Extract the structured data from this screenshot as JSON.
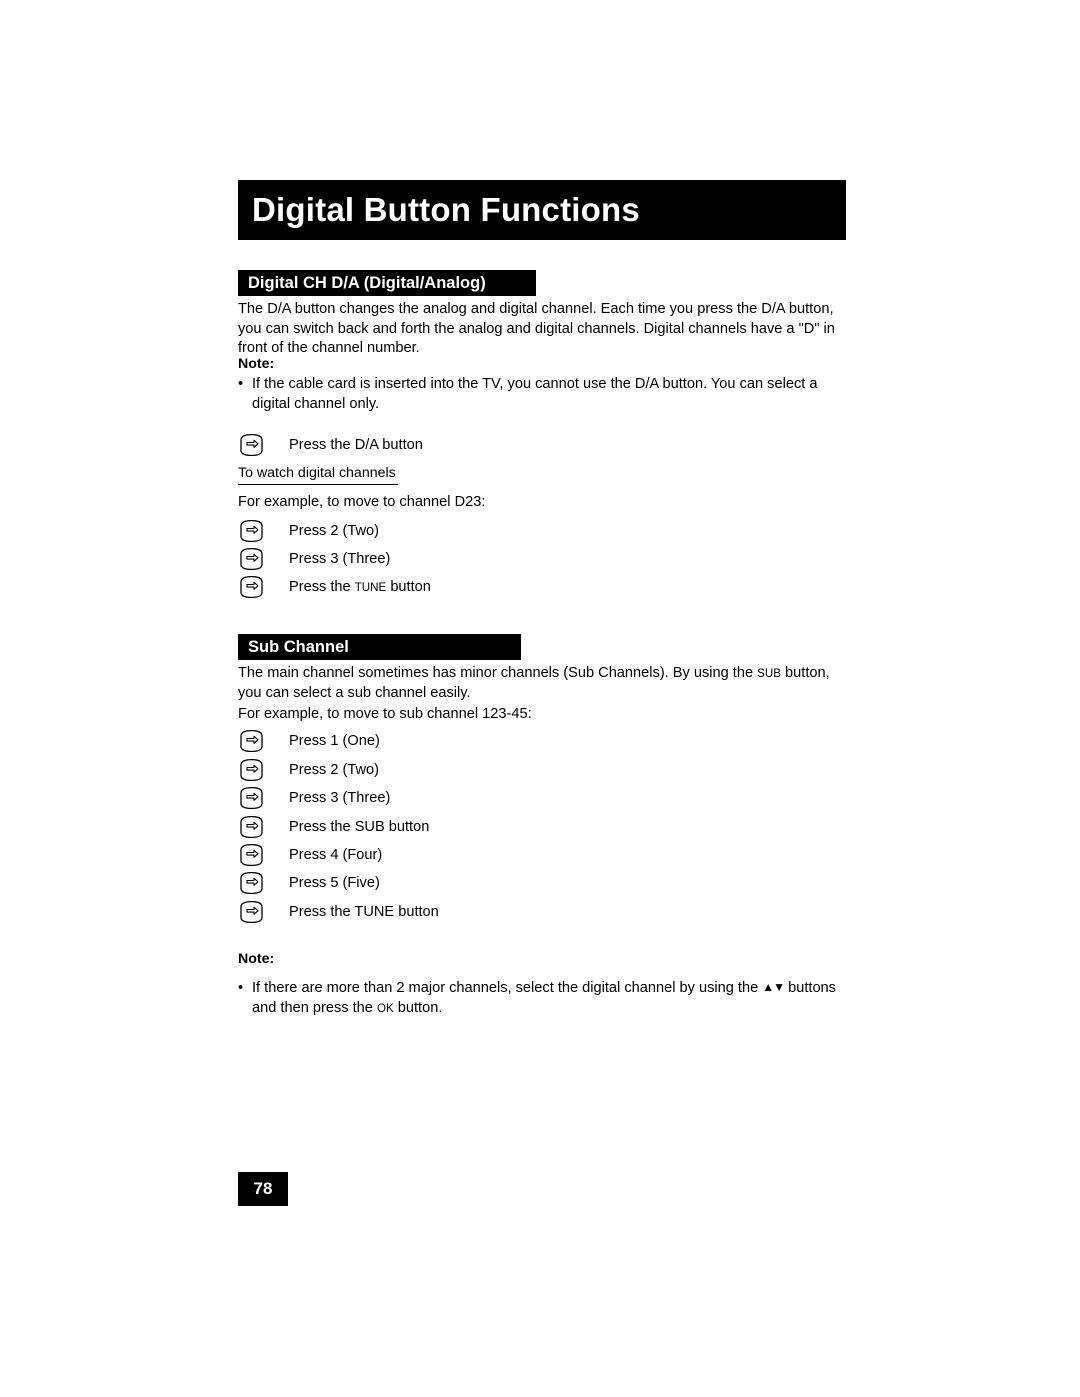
{
  "page": {
    "title": "Digital Button Functions",
    "page_number": "78"
  },
  "sections": [
    {
      "heading": "Digital CH D/A (Digital/Analog)",
      "paragraph": "The D/A button changes the analog and digital channel.  Each time you press the D/A button, you can switch back and forth the analog and digital channels.  Digital channels have a \"D\" in front of the channel number.",
      "note_label": "Note:",
      "note_bullet": "If the cable card is inserted into the TV, you cannot use the D/A button.  You can select a digital channel only.",
      "steps_top": [
        {
          "icon": "remote-key-icon",
          "label": "Press the D/A button"
        }
      ],
      "sublabel": "To watch digital channels",
      "example": "For example, to move to channel D23:",
      "steps": [
        {
          "icon": "remote-key-icon",
          "label": "Press 2 (Two)"
        },
        {
          "icon": "remote-key-icon",
          "label": "Press 3 (Three)"
        },
        {
          "icon": "remote-key-icon",
          "label_pre": "Press the ",
          "label_sc": "TUNE",
          "label_post": " button"
        }
      ]
    },
    {
      "heading": "Sub Channel",
      "paragraph_pre": "The main channel sometimes has minor channels (Sub Channels).  By using the ",
      "paragraph_sc": "SUB",
      "paragraph_post": " button, you can select a sub channel easily.",
      "example": "For example, to move to sub channel 123-45:",
      "steps": [
        {
          "icon": "remote-key-icon",
          "label": "Press 1 (One)"
        },
        {
          "icon": "remote-key-icon",
          "label": "Press 2 (Two)"
        },
        {
          "icon": "remote-key-icon",
          "label": "Press 3 (Three)"
        },
        {
          "icon": "remote-key-icon",
          "label": "Press the SUB button"
        },
        {
          "icon": "remote-key-icon",
          "label": "Press 4 (Four)"
        },
        {
          "icon": "remote-key-icon",
          "label": "Press 5 (Five)"
        },
        {
          "icon": "remote-key-icon",
          "label": "Press the TUNE button"
        }
      ],
      "note_label": "Note:",
      "note_bullet_pre": "If there are more than 2 major channels, select the digital channel by using the ",
      "note_bullet_arrows": "▲▼",
      "note_bullet_mid": " buttons and then press the ",
      "note_bullet_sc": "OK",
      "note_bullet_post": " button."
    }
  ]
}
